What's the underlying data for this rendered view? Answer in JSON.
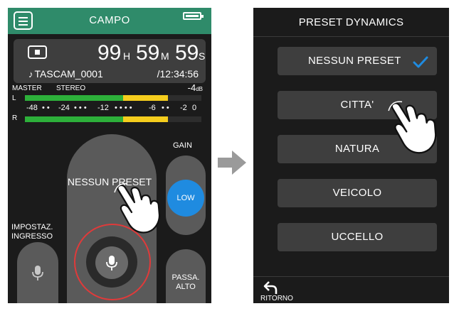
{
  "left_screen": {
    "title": "CAMPO",
    "time": {
      "hours": "99",
      "h_unit": "H",
      "minutes": "59",
      "m_unit": "M",
      "seconds": "59",
      "s_unit": "S"
    },
    "file_name": "TASCAM_0001",
    "total_time": "/12:34:56",
    "master_label": "MASTER",
    "stereo_label": "STEREO",
    "level_value": "-4",
    "level_unit": "dB",
    "meter": {
      "left_label": "L",
      "right_label": "R",
      "scale": [
        "-48",
        "-24",
        "-12",
        "-6",
        "-2",
        "0"
      ],
      "left_level": 0.82,
      "right_level": 0.82
    },
    "knob_label": "NESSUN PRESET",
    "gain_label": "GAIN",
    "gain_value": "LOW",
    "input_settings_line1": "IMPOSTAZ.",
    "input_settings_line2": "INGRESSO",
    "high_pass_line1": "PASSA.",
    "high_pass_line2": "ALTO"
  },
  "right_screen": {
    "title": "PRESET DYNAMICS",
    "presets": [
      "NESSUN PRESET",
      "CITTA'",
      "NATURA",
      "VEICOLO",
      "UCCELLO"
    ],
    "selected_preset": "NESSUN PRESET",
    "back_label": "RITORNO"
  },
  "colors": {
    "header_green": "#2f8b6a",
    "accent_blue": "#1f8be0",
    "rec_red": "#e03a3a",
    "meter_green": "#2db03a",
    "meter_yellow": "#f5cd1d",
    "check_blue": "#1f8be0"
  },
  "icons": [
    "menu-icon",
    "battery-icon",
    "stop-icon",
    "note-icon",
    "mic-icon",
    "hand-pointer-icon",
    "arrow-right-icon",
    "check-icon",
    "back-arrow-icon"
  ]
}
